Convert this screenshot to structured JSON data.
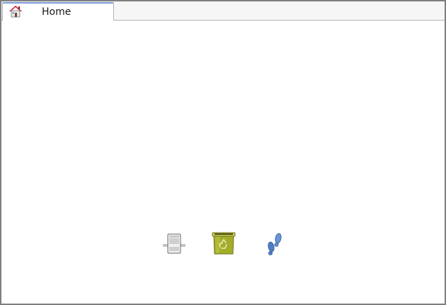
{
  "tabs": [
    {
      "label": "Home",
      "icon": "home-icon",
      "active": true
    }
  ],
  "desktop": {
    "icons": [
      {
        "icon": "file-server-icon"
      },
      {
        "icon": "trash-icon"
      },
      {
        "icon": "footprints-icon"
      }
    ]
  },
  "colors": {
    "window_border": "#7f7f7f",
    "tab_active_top": "#7b9ad6",
    "trash_green": "#a3ad2a",
    "home_roof_red": "#c8102e",
    "footprint_blue": "#4f7fc2"
  }
}
